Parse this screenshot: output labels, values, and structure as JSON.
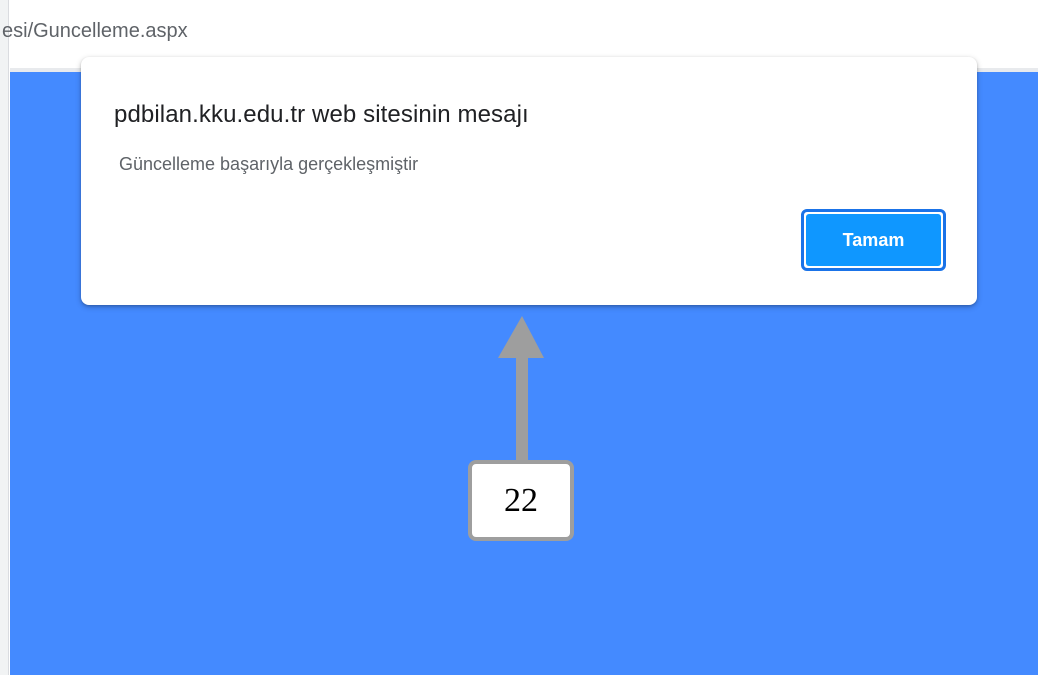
{
  "browser": {
    "url_text": "esi/Guncelleme.aspx"
  },
  "dialog": {
    "title": "pdbilan.kku.edu.tr web sitesinin mesajı",
    "message": "Güncelleme başarıyla gerçekleşmiştir",
    "ok_label": "Tamam"
  },
  "annotation": {
    "number": "22"
  },
  "colors": {
    "page_background": "#448aff",
    "button_fill": "#0f97ff",
    "button_focus_ring": "#1a73e8",
    "arrow": "#9e9e9e"
  },
  "icons": {
    "annotation_arrow": "arrow-up-icon"
  }
}
